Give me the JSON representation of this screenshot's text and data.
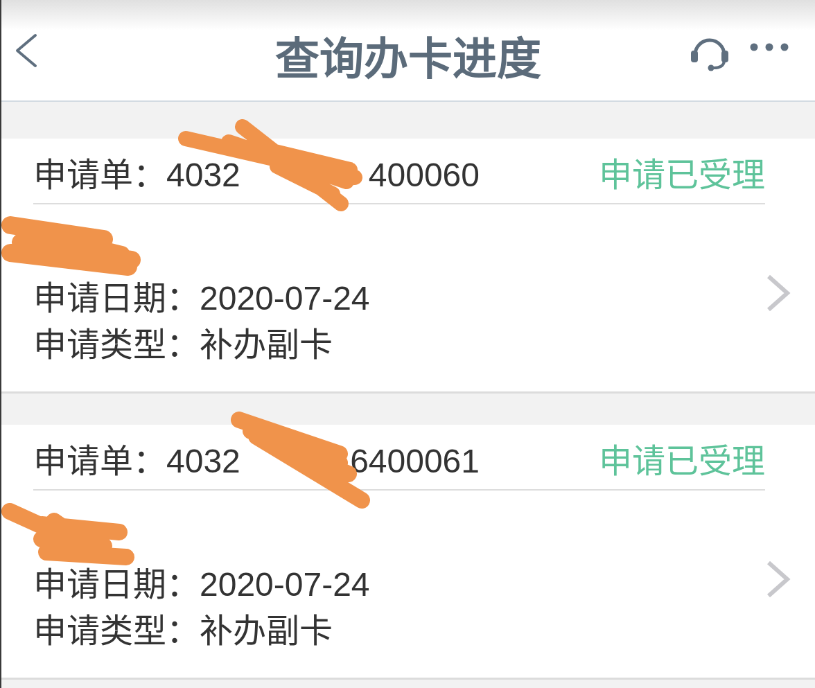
{
  "header": {
    "title": "查询办卡进度"
  },
  "applications": [
    {
      "number_label": "申请单：",
      "number_start": "4032",
      "number_end": "400060",
      "status": "申请已受理",
      "redacted": true,
      "date_label": "申请日期：",
      "date": "2020-07-24",
      "type_label": "申请类型：",
      "type": "补办副卡"
    },
    {
      "number_label": "申请单：",
      "number_start": "4032",
      "number_end": "6400061",
      "status": "申请已受理",
      "redacted": true,
      "date_label": "申请日期：",
      "date": "2020-07-24",
      "type_label": "申请类型：",
      "type": "补办副卡"
    }
  ]
}
